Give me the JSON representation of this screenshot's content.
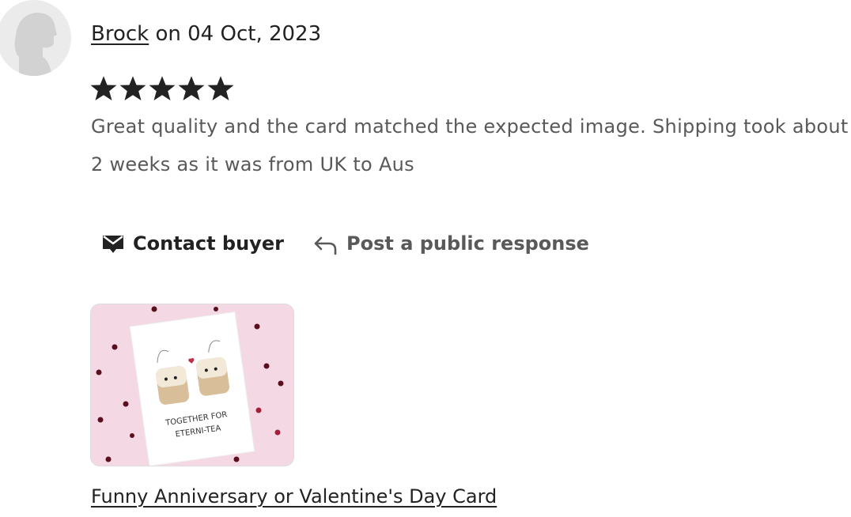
{
  "review": {
    "reviewer_name": "Brock",
    "date_prefix": " on ",
    "date": "04 Oct, 2023",
    "rating": 5,
    "rating_max": 5,
    "text": "Great quality and the card matched the expected image. Shipping took about 2 weeks as it was from UK to Aus"
  },
  "actions": {
    "contact_label": "Contact buyer",
    "respond_label": "Post a public response"
  },
  "listing": {
    "title": "Funny Anniversary or Valentine's Day Card",
    "card_text_line1": "TOGETHER FOR",
    "card_text_line2": "ETERNI-TEA"
  },
  "colors": {
    "star": "#222222",
    "heart": "#8b1a3a",
    "thumb_bg": "#f4d9e5"
  },
  "icons": [
    "avatar-placeholder",
    "star-icon",
    "envelope-icon",
    "reply-arrow-icon"
  ]
}
